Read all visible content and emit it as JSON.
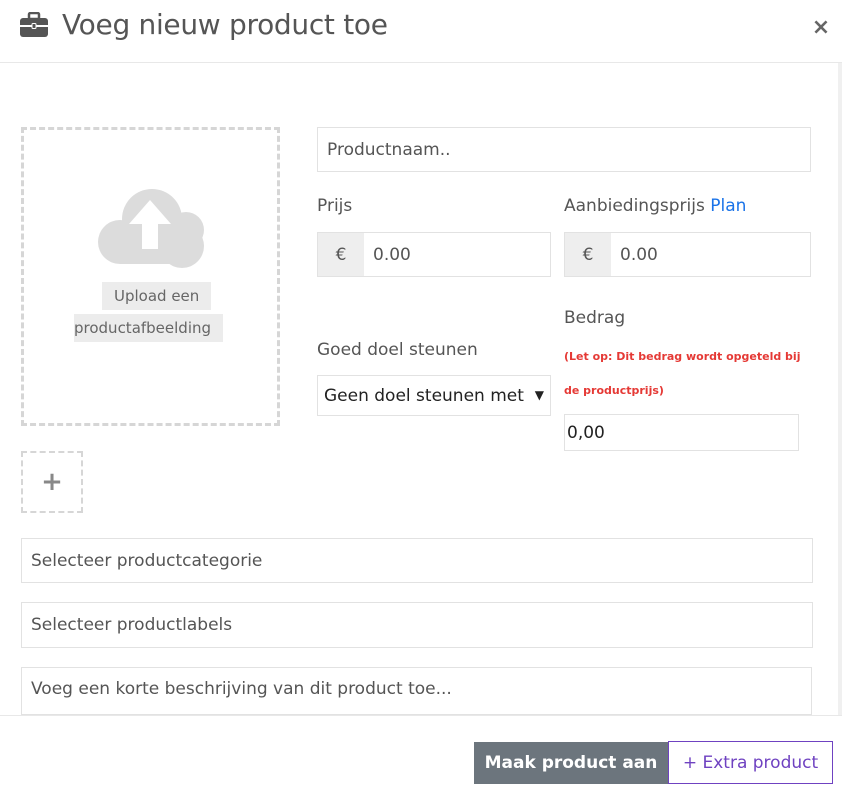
{
  "header": {
    "title": "Voeg nieuw product toe",
    "icon": "briefcase-icon",
    "close_label": "×"
  },
  "upload": {
    "icon": "cloud-upload-icon",
    "line1": "Upload een",
    "line2": "productafbeelding",
    "add_label": "+"
  },
  "form": {
    "product_name_placeholder": "Productnaam..",
    "price_label": "Prijs",
    "price_currency": "€",
    "price_value": "0.00",
    "offer_label": "Aanbiedingsprijs",
    "offer_link": "Plan",
    "offer_currency": "€",
    "offer_value": "0.00",
    "amount_label": "Bedrag",
    "amount_warning": "(Let op: Dit bedrag wordt opgeteld bij de productprijs)",
    "amount_value": "0,00",
    "charity_label": "Goed doel steunen",
    "charity_selected": "Geen doel steunen met",
    "category_placeholder": "Selecteer productcategorie",
    "labels_placeholder": "Selecteer productlabels",
    "description_placeholder": "Voeg een korte beschrijving van dit product toe..."
  },
  "footer": {
    "create_label": "Maak product aan",
    "extra_label": "+ Extra product"
  },
  "colors": {
    "primary_button": "#6c757d",
    "secondary_button": "#6f42c1",
    "link": "#1a73e8",
    "warning": "#e53935"
  }
}
